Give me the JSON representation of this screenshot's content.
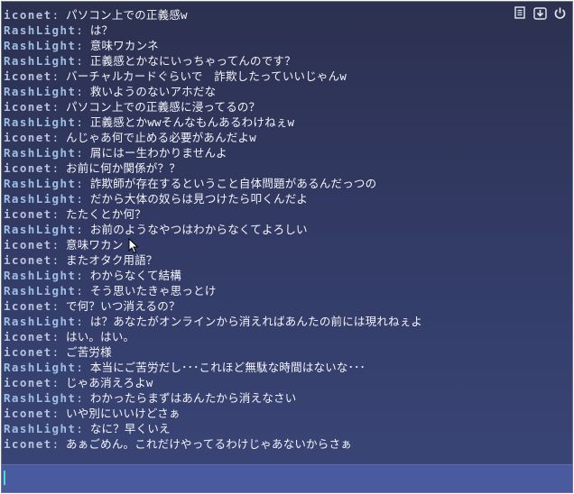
{
  "window": {
    "controls": [
      {
        "name": "note-icon"
      },
      {
        "name": "download-icon"
      },
      {
        "name": "power-icon"
      }
    ]
  },
  "chat": {
    "separator": ":",
    "lines": [
      {
        "speaker": "iconet",
        "text": "パソコン上での正義感w"
      },
      {
        "speaker": "RashLight",
        "text": "は？"
      },
      {
        "speaker": "RashLight",
        "text": "意味ワカンネ"
      },
      {
        "speaker": "RashLight",
        "text": "正義感とかなにいっちゃってんのです？"
      },
      {
        "speaker": "iconet",
        "text": "バーチャルカードぐらいで　詐欺したっていいじゃんw"
      },
      {
        "speaker": "RashLight",
        "text": "救いようのないアホだな"
      },
      {
        "speaker": "iconet",
        "text": "パソコン上での正義感に浸ってるの？"
      },
      {
        "speaker": "RashLight",
        "text": "正義感とかwwそんなもんあるわけねぇw"
      },
      {
        "speaker": "iconet",
        "text": "んじゃあ何で止める必要があんだよw"
      },
      {
        "speaker": "RashLight",
        "text": "屑にはー生わかりませんよ"
      },
      {
        "speaker": "iconet",
        "text": "お前に何か関係が？？"
      },
      {
        "speaker": "RashLight",
        "text": "詐欺師が存在するということ自体問題があるんだっつの"
      },
      {
        "speaker": "RashLight",
        "text": "だから大体の奴らは見つけたら叩くんだよ"
      },
      {
        "speaker": "iconet",
        "text": "たたくとか何？"
      },
      {
        "speaker": "RashLight",
        "text": "お前のようなやつはわからなくてよろしい"
      },
      {
        "speaker": "iconet",
        "text": "意味ワカン"
      },
      {
        "speaker": "iconet",
        "text": "またオタク用語？"
      },
      {
        "speaker": "RashLight",
        "text": "わからなくて結構"
      },
      {
        "speaker": "RashLight",
        "text": "そう思いたきゃ思っとけ"
      },
      {
        "speaker": "iconet",
        "text": "で何？いつ消えるの？"
      },
      {
        "speaker": "RashLight",
        "text": "は？あなたがオンラインから消えればあんたの前には現れねぇよ"
      },
      {
        "speaker": "iconet",
        "text": "はい。はい。"
      },
      {
        "speaker": "iconet",
        "text": "ご苦労様"
      },
      {
        "speaker": "RashLight",
        "text": "本当にご苦労だし･･･これほど無駄な時間はないな･･･"
      },
      {
        "speaker": "iconet",
        "text": "じゃあ消えろよw"
      },
      {
        "speaker": "RashLight",
        "text": "わかったらまずはあんたから消えなさい"
      },
      {
        "speaker": "iconet",
        "text": "いや別にいいけどさぁ"
      },
      {
        "speaker": "RashLight",
        "text": "なに？早くいえ"
      },
      {
        "speaker": "iconet",
        "text": "あぁごめん。これだけやってるわけじゃあないからさぁ"
      }
    ]
  },
  "input": {
    "value": ""
  },
  "colors": {
    "background_top": "#2c3150",
    "background_bottom": "#3a4678",
    "speaker_iconet": "#b9c3dd",
    "speaker_rashlight": "#9fc0e4",
    "message_text": "#f4f4f8",
    "input_bar": "#4a5a9e",
    "caret": "#4fd8d4"
  }
}
